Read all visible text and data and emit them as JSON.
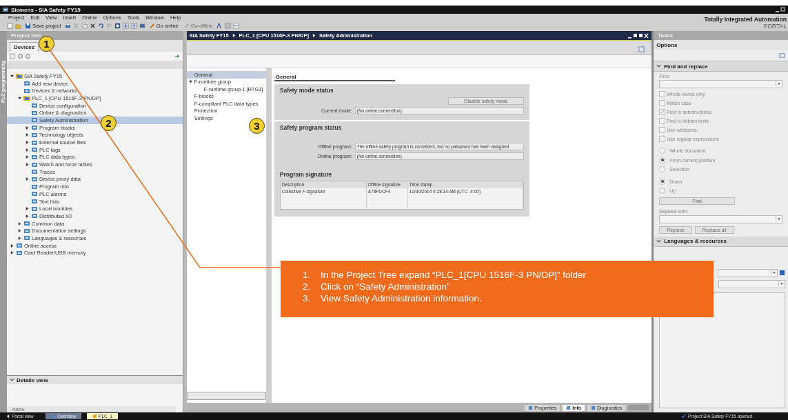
{
  "window": {
    "title": "Siemens - SIA Safety FY15"
  },
  "menu": [
    "Project",
    "Edit",
    "View",
    "Insert",
    "Online",
    "Options",
    "Tools",
    "Window",
    "Help"
  ],
  "toolbar": {
    "save": "Save project",
    "go_online": "Go online",
    "go_offline": "Go offline"
  },
  "brand": {
    "line1": "Totally Integrated Automation",
    "line2": "PORTAL"
  },
  "side_tab": "PLC programming",
  "project_tree": {
    "title": "Project tree",
    "tabs": [
      {
        "label": "Devices",
        "selected": true
      }
    ],
    "items": [
      {
        "label": "SIA Safety FY15",
        "expanded": true,
        "selected": false,
        "children": [
          {
            "label": "Add new device",
            "selected": false
          },
          {
            "label": "Devices & networks",
            "selected": false
          },
          {
            "label": "PLC_1 [CPU 1516F-3 PN/DP]",
            "expanded": true,
            "selected": false,
            "children": [
              {
                "label": "Device configuration",
                "selected": false
              },
              {
                "label": "Online & diagnostics",
                "selected": false
              },
              {
                "label": "Safety Administration",
                "selected": true
              },
              {
                "label": "Program blocks",
                "expanded": false,
                "selected": false
              },
              {
                "label": "Technology objects",
                "expanded": false,
                "selected": false
              },
              {
                "label": "External source files",
                "expanded": false,
                "selected": false
              },
              {
                "label": "PLC tags",
                "expanded": false,
                "selected": false
              },
              {
                "label": "PLC data types",
                "expanded": false,
                "selected": false
              },
              {
                "label": "Watch and force tables",
                "expanded": false,
                "selected": false
              },
              {
                "label": "Traces",
                "selected": false
              },
              {
                "label": "Device proxy data",
                "expanded": false,
                "selected": false
              },
              {
                "label": "Program info",
                "selected": false
              },
              {
                "label": "PLC alarms",
                "selected": false
              },
              {
                "label": "Text lists",
                "selected": false
              },
              {
                "label": "Local modules",
                "expanded": false,
                "selected": false
              },
              {
                "label": "Distributed I/O",
                "expanded": false,
                "selected": false
              }
            ]
          },
          {
            "label": "Common data",
            "expanded": false,
            "selected": false
          },
          {
            "label": "Documentation settings",
            "expanded": false,
            "selected": false
          },
          {
            "label": "Languages & resources",
            "expanded": false,
            "selected": false
          }
        ]
      },
      {
        "label": "Online access",
        "expanded": false,
        "selected": false
      },
      {
        "label": "Card Reader/USB memory",
        "expanded": false,
        "selected": false
      }
    ],
    "details": {
      "title": "Details view",
      "column": "Name"
    }
  },
  "editor": {
    "breadcrumb": [
      "SIA Safety FY15",
      "PLC_1 [CPU 1516F-3 PN/DP]",
      "Safety Administration"
    ],
    "nav": [
      {
        "label": "General",
        "selected": true
      },
      {
        "label": "F-runtime group",
        "expanded": true,
        "selected": false,
        "children": [
          {
            "label": "F-runtime group 1 [RTG1]",
            "selected": false
          }
        ]
      },
      {
        "label": "F-blocks",
        "selected": false
      },
      {
        "label": "F-compliant PLC data types",
        "selected": false
      },
      {
        "label": "Protection",
        "selected": false
      },
      {
        "label": "Settings",
        "selected": false
      }
    ],
    "heading": "General",
    "safety_mode": {
      "title": "Safety mode status",
      "button": "Disable safety mode",
      "field": {
        "label": "Current mode:",
        "value": "(No online connection)"
      }
    },
    "safety_program": {
      "title": "Safety program status",
      "fields": [
        {
          "label": "Offline program:",
          "value": "The offline safety program is consistent, but no password has been assigned"
        },
        {
          "label": "Online program:",
          "value": "(No online connection)"
        }
      ]
    },
    "signature": {
      "title": "Program signature",
      "columns": [
        "Description",
        "Offline signature",
        "Time stamp"
      ],
      "rows": [
        [
          "Collective F-signature",
          "A78FDCF4",
          "10/30/2014 9:28:14 AM (UTC -4:00)"
        ]
      ]
    }
  },
  "bottom_tabs": [
    {
      "label": "Properties",
      "selected": false
    },
    {
      "label": "Info",
      "selected": true
    },
    {
      "label": "Diagnostics",
      "selected": false
    }
  ],
  "tasks": {
    "title": "Tasks",
    "options": "Options",
    "find_replace": {
      "title": "Find and replace",
      "find_label": "Find:",
      "checkboxes": [
        {
          "label": "Whole words only",
          "checked": false
        },
        {
          "label": "Match case",
          "checked": false
        },
        {
          "label": "Find in substructures",
          "checked": true
        },
        {
          "label": "Find in hidden texts",
          "checked": false
        },
        {
          "label": "Use wildcards",
          "checked": false
        },
        {
          "label": "Use regular expressions",
          "checked": false
        }
      ],
      "scope": [
        {
          "label": "Whole document",
          "selected": false
        },
        {
          "label": "From current position",
          "selected": true
        },
        {
          "label": "Selection",
          "selected": false
        }
      ],
      "direction": [
        {
          "label": "Down",
          "selected": true
        },
        {
          "label": "Up",
          "selected": false
        }
      ],
      "find_button": "Find",
      "replace_label": "Replace with:",
      "buttons": [
        "Replace",
        "Replace all"
      ]
    },
    "languages": {
      "title": "Languages & resources"
    }
  },
  "status_bar": {
    "portal_view": "Portal view",
    "tabs": [
      {
        "label": "Overview",
        "selected": false
      },
      {
        "label": "PLC_1",
        "selected": true
      }
    ],
    "message": "Project SIA Safety FY15 opened."
  },
  "callout": {
    "markers": [
      "1",
      "2",
      "3"
    ],
    "steps": [
      {
        "number": "1.",
        "text": "In the Project Tree expand “PLC_1[CPU 1516F-3 PN/DP]” folder"
      },
      {
        "number": "2.",
        "text": "Click on “Safety Administration”"
      },
      {
        "number": "3.",
        "text": "View Safety Administration information."
      }
    ]
  }
}
